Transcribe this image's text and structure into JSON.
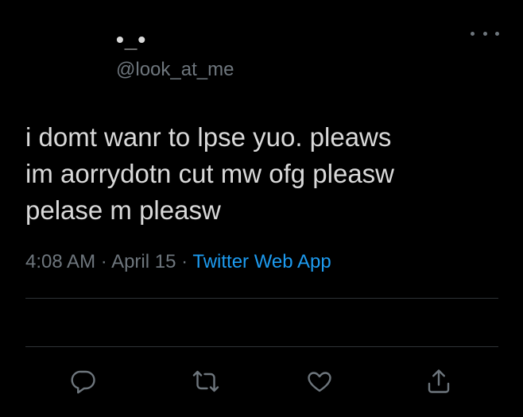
{
  "author": {
    "display_name": "•_•",
    "handle": "@look_at_me"
  },
  "tweet": {
    "text": "i domt wanr to lpse yuo. pleaws\nim aorrydotn cut mw ofg pleasw\npelase m pleasw"
  },
  "meta": {
    "time": "4:08 AM",
    "separator": " · ",
    "date": "April 15",
    "source": "Twitter Web App"
  },
  "actions": [
    {
      "icon": "reply-icon"
    },
    {
      "icon": "retweet-icon"
    },
    {
      "icon": "like-icon"
    },
    {
      "icon": "share-icon"
    }
  ],
  "colors": {
    "background": "#000000",
    "text": "#d9d9d9",
    "muted": "#6e767d",
    "link": "#1d9bf0",
    "divider": "#2f3336"
  }
}
